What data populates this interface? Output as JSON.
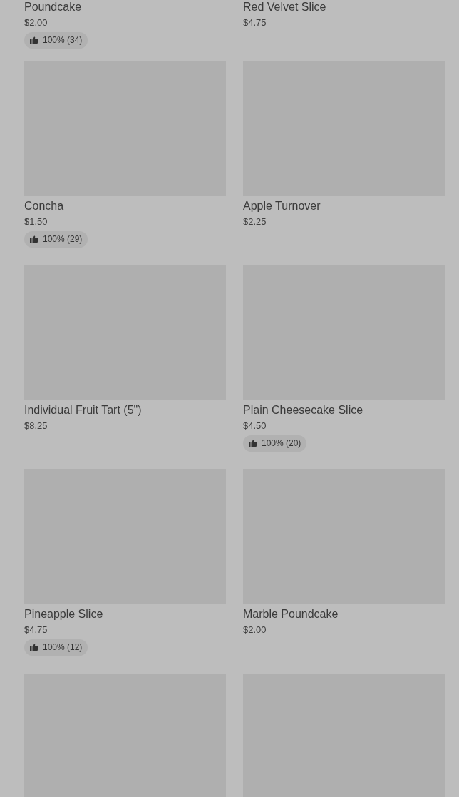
{
  "products": [
    {
      "kind": "text_only",
      "name": "Poundcake",
      "price": "$2.00",
      "rating": "100% (34)"
    },
    {
      "kind": "text_only",
      "name": "Red Velvet Slice",
      "price": "$4.75"
    },
    {
      "kind": "full",
      "name": "Concha",
      "price": "$1.50",
      "rating": "100% (29)"
    },
    {
      "kind": "full",
      "name": "Apple Turnover",
      "price": "$2.25"
    },
    {
      "kind": "full",
      "name": "Individual Fruit Tart (5\")",
      "price": "$8.25"
    },
    {
      "kind": "full",
      "name": "Plain Cheesecake Slice",
      "price": "$4.50",
      "rating": "100% (20)"
    },
    {
      "kind": "full",
      "name": "Pineapple Slice",
      "price": "$4.75",
      "rating": "100% (12)"
    },
    {
      "kind": "full",
      "name": "Marble Poundcake",
      "price": "$2.00"
    },
    {
      "kind": "image_only"
    },
    {
      "kind": "image_only"
    }
  ]
}
